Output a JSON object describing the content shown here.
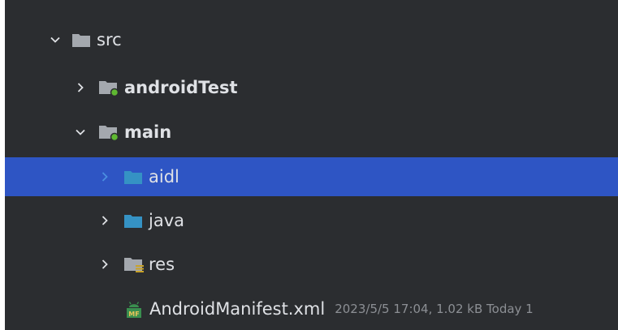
{
  "theme": {
    "panel_bg": "#2b2d30",
    "selection_bg": "#2e55c4",
    "text": "#dfe1e5",
    "muted": "#8c8f94",
    "folder_gray": "#a4a8ae",
    "folder_blue": "#3592c4",
    "source_dot": "#5fb832",
    "res_stripes": "#c9a227",
    "manifest_green": "#3a8f4f"
  },
  "tree": {
    "nodes": [
      {
        "label": "src",
        "icon": "folder-icon",
        "expanded": true,
        "bold": false
      },
      {
        "label": "androidTest",
        "icon": "test-source-folder-icon",
        "expanded": false,
        "bold": true
      },
      {
        "label": "main",
        "icon": "source-folder-icon",
        "expanded": true,
        "bold": true
      },
      {
        "label": "aidl",
        "icon": "source-root-folder-icon",
        "expanded": false,
        "bold": false,
        "selected": true
      },
      {
        "label": "java",
        "icon": "source-root-folder-icon",
        "expanded": false,
        "bold": false
      },
      {
        "label": "res",
        "icon": "resources-folder-icon",
        "expanded": false,
        "bold": false
      },
      {
        "label": "AndroidManifest.xml",
        "icon": "manifest-file-icon",
        "meta": "2023/5/5 17:04, 1.02 kB Today 1"
      }
    ]
  }
}
